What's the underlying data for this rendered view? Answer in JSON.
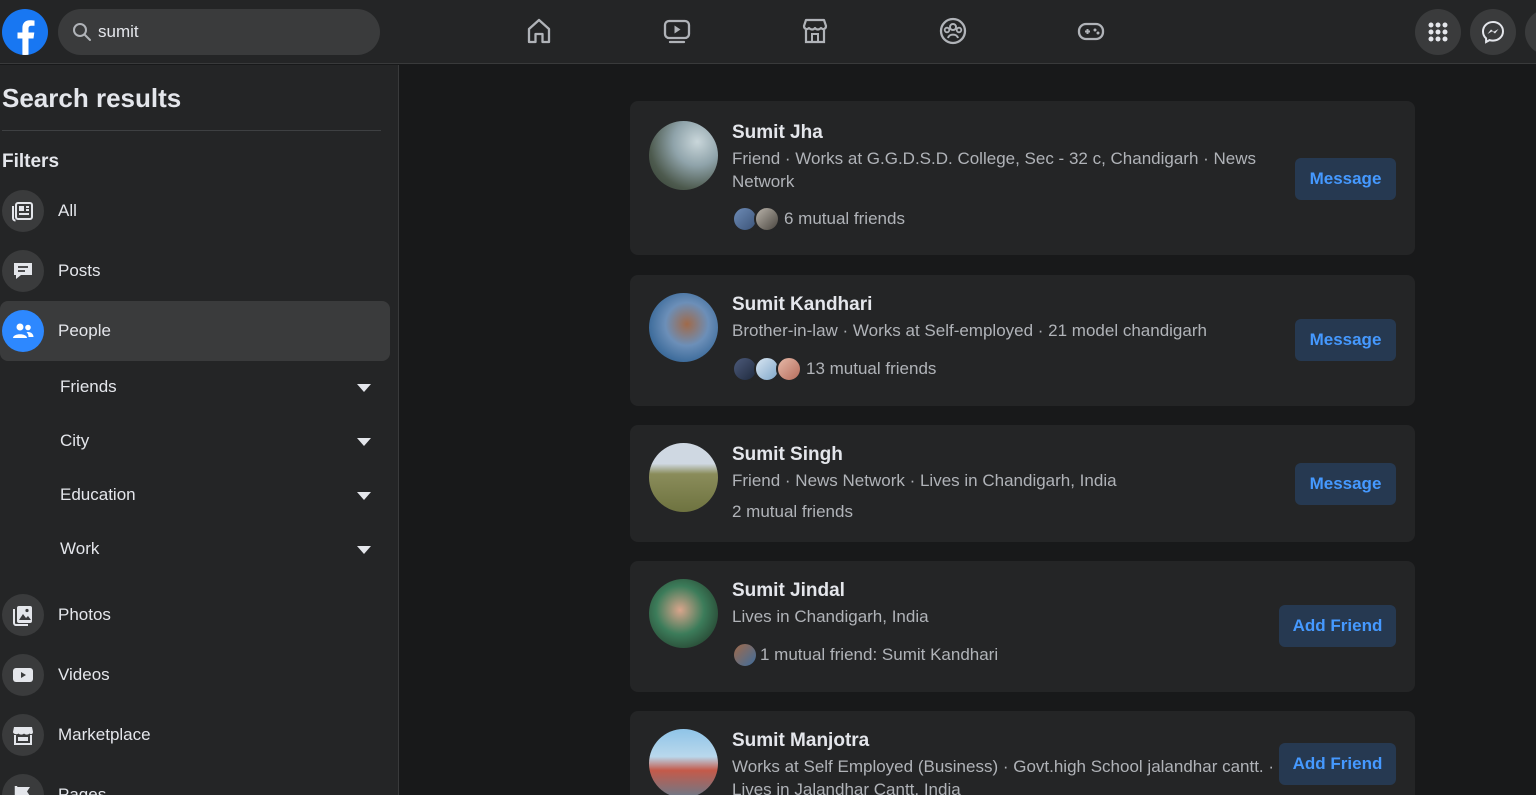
{
  "search": {
    "value": "sumit"
  },
  "sidebar": {
    "title": "Search results",
    "filters_label": "Filters",
    "items_top": [
      {
        "label": "All",
        "icon": "all-results-icon"
      },
      {
        "label": "Posts",
        "icon": "posts-icon"
      },
      {
        "label": "People",
        "icon": "people-icon",
        "active": true
      }
    ],
    "subfilters": [
      {
        "label": "Friends"
      },
      {
        "label": "City"
      },
      {
        "label": "Education"
      },
      {
        "label": "Work"
      }
    ],
    "items_bottom": [
      {
        "label": "Photos",
        "icon": "photos-icon"
      },
      {
        "label": "Videos",
        "icon": "videos-icon"
      },
      {
        "label": "Marketplace",
        "icon": "marketplace-icon"
      },
      {
        "label": "Pages",
        "icon": "pages-icon"
      }
    ]
  },
  "results": [
    {
      "name": "Sumit Jha",
      "description": "Friend · Works at G.G.D.S.D. College, Sec - 32 c, Chandigarh · News Network",
      "mutual": "6 mutual friends",
      "action": "Message"
    },
    {
      "name": "Sumit Kandhari",
      "description": "Brother-in-law · Works at Self-employed · 21 model chandigarh",
      "mutual": "13 mutual friends",
      "action": "Message"
    },
    {
      "name": "Sumit Singh",
      "description": "Friend · News Network · Lives in Chandigarh, India",
      "mutual": "2 mutual friends",
      "action": "Message"
    },
    {
      "name": "Sumit Jindal",
      "description": "Lives in Chandigarh, India",
      "mutual": "1 mutual friend: Sumit Kandhari",
      "action": "Add Friend"
    },
    {
      "name": "Sumit Manjotra",
      "description": "Works at Self Employed (Business) · Govt.high School jalandhar cantt. · Lives in Jalandhar Cantt, India",
      "mutual": "",
      "action": "Add Friend"
    }
  ],
  "colors": {
    "background": "#18191a",
    "surface": "#242526",
    "accent": "#2d88ff",
    "button_bg": "#263951",
    "button_text": "#4599ff"
  }
}
